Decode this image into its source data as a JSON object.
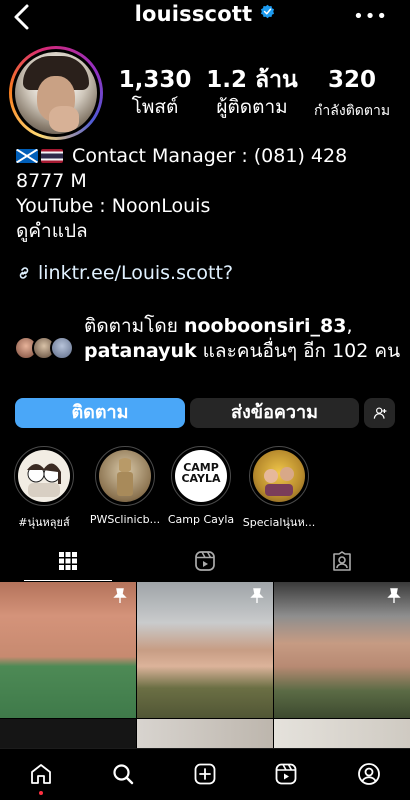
{
  "header": {
    "username": "louisscott",
    "back_icon": "chevron-left-icon",
    "verified_icon": "verified-badge-icon",
    "more_label": "•••"
  },
  "stats": [
    {
      "value": "1,330",
      "label": "โพสต์"
    },
    {
      "value": "1.2 ล้าน",
      "label": "ผู้ติดตาม"
    },
    {
      "value": "320",
      "label": "กำลังติดตาม"
    }
  ],
  "bio": {
    "line1": "Contact Manager : (081) 428",
    "line2": "8777 M",
    "line3": "YouTube : NoonLouis",
    "translate": "ดูคำแปล",
    "link": "linktr.ee/Louis.scott?"
  },
  "followed_by": {
    "prefix": "ติดตามโดย ",
    "user1": "nooboonsiri_83",
    "separator": ", ",
    "user2": "patanayuk",
    "suffix": " และคนอื่นๆ อีก 102 คน"
  },
  "actions": {
    "follow_label": "ติดตาม",
    "message_label": "ส่งข้อความ",
    "suggest_icon": "add-person-icon"
  },
  "highlights": [
    {
      "label": "#นุ่นหลุยส์"
    },
    {
      "label": "PWSclinicb..."
    },
    {
      "label": "Camp Cayla"
    },
    {
      "label": "Specialนุ่นห..."
    }
  ],
  "highlight_camp_text": {
    "line1": "CAMP",
    "line2": "CAYLA"
  },
  "tabs": [
    {
      "icon": "grid-icon",
      "active": true
    },
    {
      "icon": "reels-icon",
      "active": false
    },
    {
      "icon": "tagged-icon",
      "active": false
    }
  ],
  "bottom_nav": [
    {
      "icon": "home-icon"
    },
    {
      "icon": "search-icon"
    },
    {
      "icon": "create-icon"
    },
    {
      "icon": "reels-icon"
    },
    {
      "icon": "profile-icon"
    }
  ],
  "colors": {
    "accent_blue": "#4aa7f8",
    "button_dark": "#262626",
    "link_text": "#e0f1ff",
    "notification_dot": "#ff3040"
  }
}
